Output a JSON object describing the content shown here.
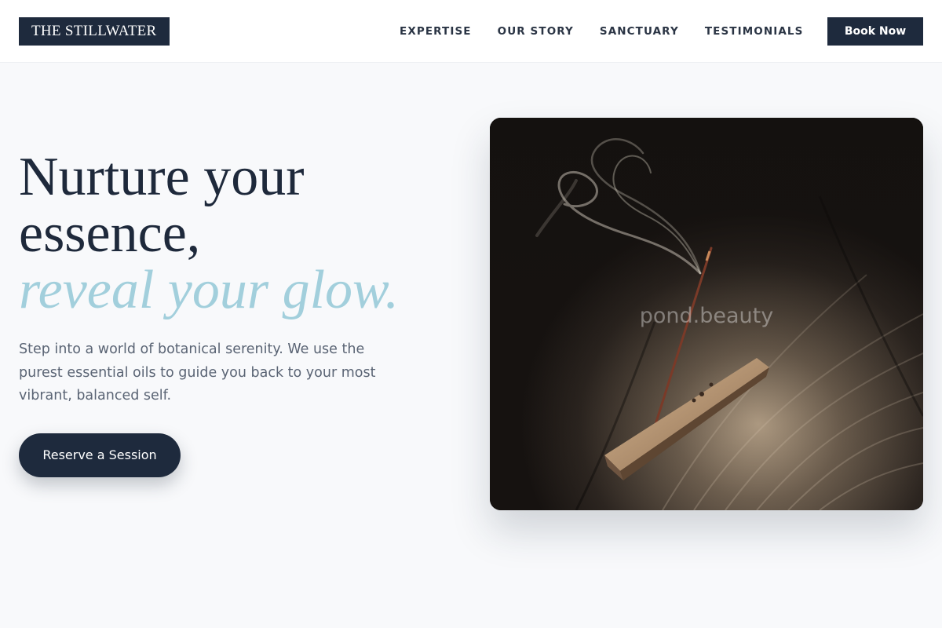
{
  "header": {
    "logo": "THE STILLWATER",
    "nav": [
      "EXPERTISE",
      "OUR STORY",
      "SANCTUARY",
      "TESTIMONIALS"
    ],
    "book_label": "Book Now"
  },
  "hero": {
    "headline_line1": "Nurture your",
    "headline_line2": "essence,",
    "headline_accent": "reveal your glow.",
    "intro": "Step into a world of botanical serenity. We use the purest essential oils to guide you back to your most vibrant, balanced self.",
    "cta_label": "Reserve a Session",
    "image_watermark": "pond.beauty"
  },
  "colors": {
    "navy": "#1e2a3d",
    "accent": "#a2cfdc",
    "background": "#f8f9fb",
    "body_text": "#5a6474"
  }
}
